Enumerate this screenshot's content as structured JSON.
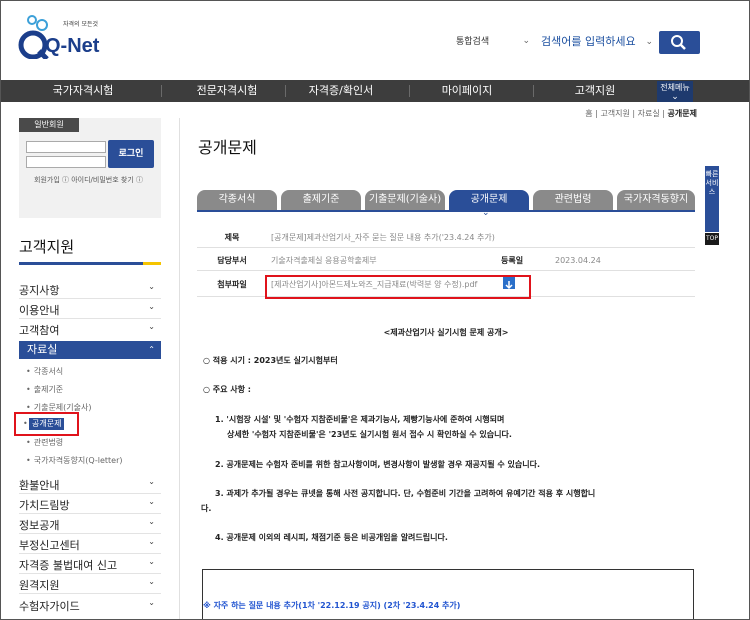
{
  "header": {
    "logo_tagline": "자격의 모든것",
    "logo_text": "Q-Net",
    "search_scope": "통합검색",
    "search_placeholder": "검색어를 입력하세요"
  },
  "gnb": {
    "items": [
      "국가자격시험",
      "전문자격시험",
      "자격증/확인서",
      "마이페이지",
      "고객지원"
    ],
    "all_menu": "전체메뉴"
  },
  "breadcrumb": {
    "items": [
      "홈",
      "고객지원",
      "자료실"
    ],
    "current": "공개문제"
  },
  "login": {
    "member_tab": "일반회원",
    "login_button": "로그인",
    "links": "회원가입 ⓘ   아이디/비밀번호 찾기 ⓘ"
  },
  "sidebar": {
    "title": "고객지원",
    "items_top": [
      "공지사항",
      "이용안내",
      "고객참여"
    ],
    "active_section": "자료실",
    "sub_items": [
      "각종서식",
      "출제기준",
      "기출문제(기술사)",
      "공개문제",
      "관련법령",
      "국가자격동향지(Q-letter)"
    ],
    "items_bottom": [
      "환불안내",
      "가치드림방",
      "정보공개",
      "부정신고센터",
      "자격증 불법대여 신고",
      "원격지원",
      "수험자가이드"
    ]
  },
  "content": {
    "page_title": "공개문제",
    "tabs": [
      "각종서식",
      "출제기준",
      "기출문제(기술사)",
      "공개문제",
      "관련법령",
      "국가자격동향지"
    ],
    "active_tab_index": 3,
    "quick_service": "빠른서비스",
    "top_button": "TOP",
    "info": {
      "subject_label": "제목",
      "subject_value": "[공개문제]제과산업기사_자주 묻는 질문 내용 추가('23.4.24 추가)",
      "dept_label": "담당부서",
      "dept_value": "기술자격출제실 응용공학출제부",
      "date_label": "등록일",
      "date_value": "2023.04.24",
      "file_label": "첨부파일",
      "file_value": "[제과산업기사]아몬드제노와즈_지급재료(박력분 양 수정).pdf"
    },
    "doc": {
      "heading": "<제과산업기사 실기시험 문제 공개>",
      "p1": "○ 적용 시기 : 2023년도 실기시험부터",
      "p2": "○ 주요 사항 :",
      "p3a": "1. '시험장 시설' 및 '수험자 지참준비물'은 제과기능사, 제빵기능사에 준하여 시행되며",
      "p3b": "상세한 '수험자 지참준비물'은 '23년도 실기시험 원서 접수 시 확인하실 수 있습니다.",
      "p4": "2. 공개문제는 수험자 준비를 위한 참고사항이며, 변경사항이 발생할 경우 재공지될 수 있습니다.",
      "p5a": "3. 과제가 추가될 경우는 큐넷을 통해 사전 공지합니다. 단, 수험준비 기간을 고려하여 유예기간 적용 후 시행합니",
      "p5b": "다.",
      "p6": "4. 공개문제 이외의 레시피, 채점기준 등은 비공개임을 알려드립니다.",
      "faq": "※ 자주 하는 질문 내용 추가(1차 '22.12.19 공지) (2차 '23.4.24 추가)"
    }
  },
  "colors": {
    "brand": "#2a4e98",
    "highlight": "#e0131b",
    "nav_bg": "#3d3d3d"
  }
}
